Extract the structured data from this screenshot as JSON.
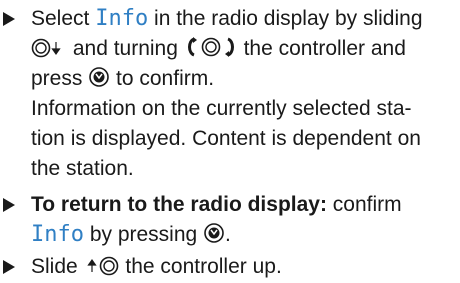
{
  "steps": [
    {
      "lines": [
        {
          "pre": "Select ",
          "kw": "Info",
          "post": " in the radio display by sliding"
        },
        {
          "post1": " and turning ",
          "post2": " the controller and"
        },
        {
          "pre": "press ",
          "post": " to confirm."
        }
      ],
      "result": [
        "Information on the currently selected sta-",
        "tion is displayed. Content is dependent on",
        "the station."
      ]
    },
    {
      "lines": [
        {
          "bold": "To return to the radio display:",
          "post": " confirm"
        },
        {
          "kw": "Info",
          "post": " by pressing "
        }
      ],
      "end": "."
    },
    {
      "lines": [
        {
          "pre": "Slide ",
          "post": " the controller up."
        }
      ]
    }
  ],
  "icons": {
    "controller_slide_down": "controller-slide-down-icon",
    "controller_turn": "controller-turn-icon",
    "controller_press": "controller-press-icon",
    "controller_slide_up": "controller-slide-up-icon"
  }
}
